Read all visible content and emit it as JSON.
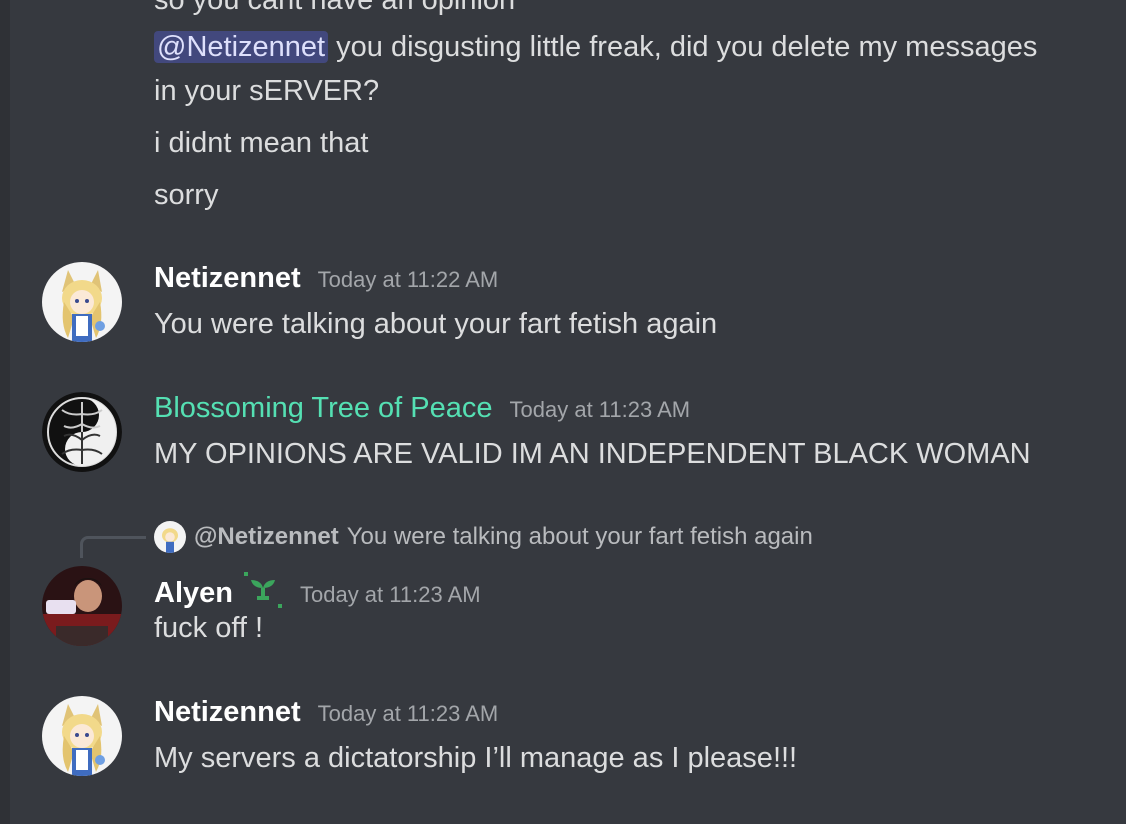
{
  "channel": {
    "colors": {
      "background": "#36393f",
      "text": "#dcddde",
      "mention_bg": "#4b5199",
      "green_username": "#55e0b3",
      "timestamp": "#a3a6aa"
    }
  },
  "messages": {
    "cut_top_text": "so you cant have an opinion",
    "group1": {
      "mention": "@Netizennet",
      "line1_rest": " you disgusting little freak, did you delete my messages",
      "line2": "in your sERVER?",
      "line3": "i didnt mean that",
      "line4": "sorry"
    },
    "m1": {
      "author": "Netizennet",
      "time": "Today at 11:22 AM",
      "text": "You were talking about your fart fetish again",
      "avatar_icon": "anime-fox-girl-avatar"
    },
    "m2": {
      "author": "Blossoming Tree of Peace",
      "time": "Today at 11:23 AM",
      "text": "MY OPINIONS ARE VALID IM AN INDEPENDENT BLACK WOMAN",
      "avatar_icon": "yin-yang-tree-avatar"
    },
    "m3": {
      "reply_author": "@Netizennet",
      "reply_text": "You were talking about your fart fetish again",
      "author": "Alyen",
      "badge_icon": "sprout-badge-icon",
      "time": "Today at 11:23 AM",
      "text": "fuck off !",
      "avatar_icon": "photo-avatar"
    },
    "m4": {
      "author": "Netizennet",
      "time": "Today at 11:23 AM",
      "text": "My servers a dictatorship I’ll manage as I please!!!",
      "avatar_icon": "anime-fox-girl-avatar"
    }
  }
}
